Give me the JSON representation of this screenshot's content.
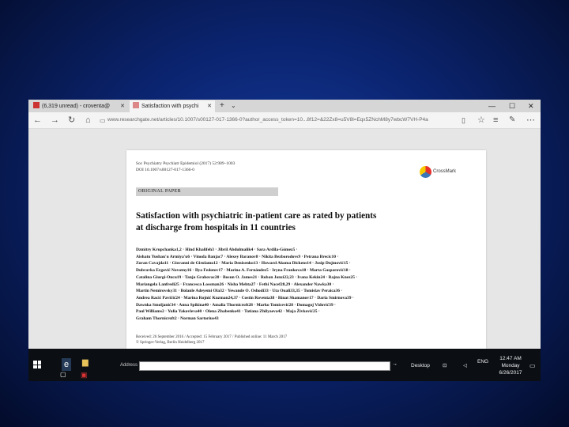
{
  "browser": {
    "tabs": [
      {
        "label": "(6,319 unread) - croventa@"
      },
      {
        "label": "Satisfaction with psychi"
      }
    ],
    "url": "www.researchgate.net/articles/10.1007/s00127-017-1366-0?author_access_token=10...8f12=&22Zx8=u5V8l=Eqx5ZNchM8y7wbcW7VH-P4a"
  },
  "paper": {
    "journal_ref": "Soc Psychiatry Psychiatr Epidemiol (2017) 52:989–1003",
    "doi": "DOI 10.1007/s00127-017-1366-0",
    "crossmark": "CrossMark",
    "section": "ORIGINAL PAPER",
    "title_line1": "Satisfaction with psychiatric in-patient care as rated by patients",
    "title_line2": "at discharge from hospitals in 11 countries",
    "authors": [
      "Dzmitry Krupchanka1,2 · Hind Khalifeh3 · Jibril Abdulmalik4 · Sara Ardila-Gómez5 ·",
      "Aishatu Yushau'u Armiya'u6 · Vinoda Banjac7 · Alexey Baranov8 · Nikita Bezborodovs9 · Petrana Brecic10 ·",
      "Zoran Cavajda11 · Giovanni de Girolamo12 · Maria Denisenko13 · Howard Akoma Dickens14 · Josip Dujmović15 ·",
      "Dubravka Ergović Novotny16 · Ilya Fedotov17 · Marina A. Fernández5 · Iryna Frankova18 · Marta Gasparović18 ·",
      "Catalina Giurgi-Oncu19 · Tanja Grahovac20 · Bosun O. James21 · Roban Jonzi22,23 · Ivana Kekin24 · Rajna Knez25 ·",
      "Mariangela Lanfredi25 · Francesca Lossman26 · Nisha Mehta27 · Fethi Nacef28,29 · Alexander Nawka30 ·",
      "Martin Nemirovsky31 · Bolanle Adeyemi Ola32 · Yewande O. Oshodi33 · Uta Ouali33,35 · Tomislav Peraica36 ·",
      "Andrea Racić Pavičić24 · Marina Rojnić Kuzman24,37 · Costin Roventa38 · Rinat Shamanov17 · Daria Smirnova39 ·",
      "Dawnka Smoljanić34 · Anna Spikina40 · Amalia Thornicroft28 · Marko Tomicević28 · Domagoj Vidović39 ·",
      "Paul Williams2 · Yulia Yakovleva40 · Olena Zhabenko41 · Tatiana Zhilyaeva42 · Maja Živković25 ·",
      "Graham Thornicroft2 · Norman Sartorius43"
    ],
    "received": "Received: 26 September 2016 / Accepted: 15 February 2017 / Published online: 11 March 2017",
    "copyright": "© Springer-Verlag, Berlin Heidelberg 2017"
  },
  "taskbar": {
    "address_label": "Address",
    "desktop_label": "Desktop",
    "language": "ENG",
    "time": "12:47 AM",
    "day": "Monday",
    "date": "6/26/2017"
  }
}
